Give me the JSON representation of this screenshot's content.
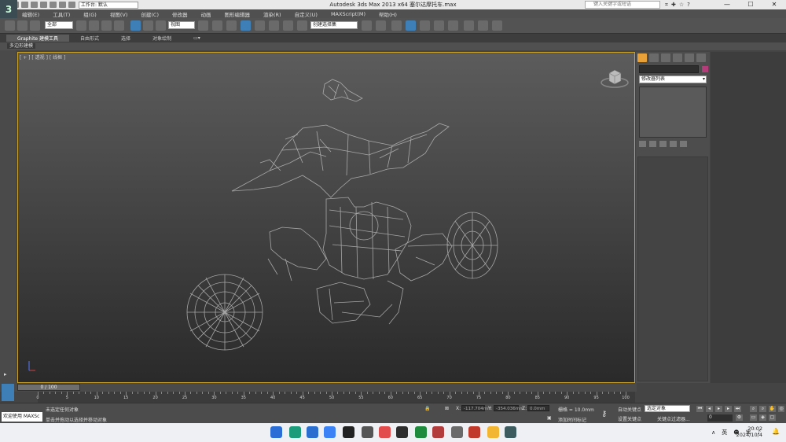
{
  "titlebar": {
    "workspace": "工作台: 默认",
    "app_title": "Autodesk 3ds Max  2013 x64     塞尔达摩托车.max",
    "search_placeholder": "键入关键字或短语",
    "window_controls": [
      "—",
      "☐",
      "✕"
    ]
  },
  "menu": [
    "编辑(E)",
    "工具(T)",
    "组(G)",
    "视图(V)",
    "创建(C)",
    "修改器",
    "动画",
    "图形编辑器",
    "渲染(R)",
    "自定义(U)",
    "MAXScript(M)",
    "帮助(H)"
  ],
  "toolbar": {
    "selection_filter": "全部",
    "ref_coord": "视图",
    "named_selection": "创建选择集"
  },
  "ribbon": {
    "tabs": [
      "Graphite 建模工具",
      "自由形式",
      "选择",
      "对象绘制"
    ],
    "subtab": "多边形建模"
  },
  "viewport": {
    "label": "[ + ] [ 透视 ] [ 线框 ]"
  },
  "command_panel": {
    "modifier_list": "修改器列表"
  },
  "timeline": {
    "slider": "0 / 100",
    "ruler_labels": [
      "0",
      "5",
      "10",
      "15",
      "20",
      "25",
      "30",
      "35",
      "40",
      "45",
      "50",
      "55",
      "60",
      "65",
      "70",
      "75",
      "80",
      "85",
      "90",
      "95",
      "100"
    ]
  },
  "status": {
    "welcome": "欢迎使用 MAXSc",
    "line1": "未选定任何对象",
    "line2": "单击并拖动以选择并移动对象",
    "x_label": "X:",
    "x_value": "-117.704mm",
    "y_label": "Y:",
    "y_value": "-354.036mm",
    "z_label": "Z:",
    "z_value": "0.0mm",
    "grid": "栅格 = 10.0mm",
    "add_time_tag": "添加时间标记",
    "auto_key": "自动关键点",
    "set_key": "设置关键点",
    "selected_object": "选定对象",
    "key_filters": "关键点过滤器...",
    "frame": "0"
  },
  "taskbar": {
    "tray": [
      "∧",
      "英"
    ],
    "time": "20:02",
    "date": "2024/10/4"
  },
  "colors": {
    "viewport_border": "#c9a227",
    "active_tool": "#3f7fb8",
    "object_color": "#b43c7a"
  }
}
